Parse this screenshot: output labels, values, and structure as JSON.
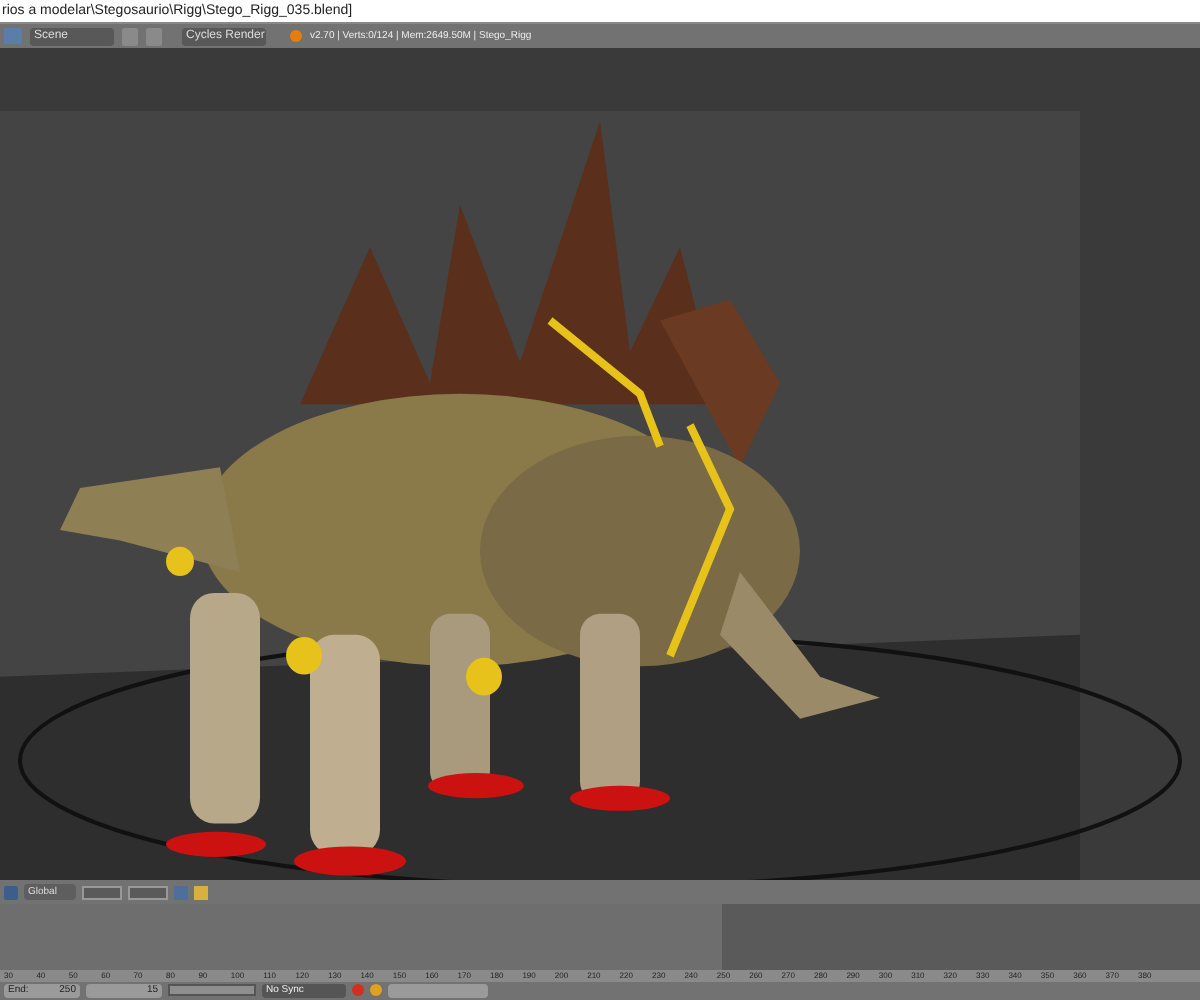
{
  "window": {
    "title": "rios a modelar\\Stegosaurio\\Rigg\\Stego_Rigg_035.blend]"
  },
  "info_header": {
    "scene": "Scene",
    "render_engine": "Cycles Render",
    "stats": "v2.70 | Verts:0/124 | Mem:2649.50M | Stego_Rigg"
  },
  "view_header": {
    "orientation": "Global"
  },
  "timeline": {
    "ticks": [
      "30",
      "40",
      "50",
      "60",
      "70",
      "80",
      "90",
      "100",
      "110",
      "120",
      "130",
      "140",
      "150",
      "160",
      "170",
      "180",
      "190",
      "200",
      "210",
      "220",
      "230",
      "240",
      "250",
      "260",
      "270",
      "280",
      "290",
      "300",
      "310",
      "320",
      "330",
      "340",
      "350",
      "360",
      "370",
      "380"
    ],
    "end": {
      "label": "End:",
      "value": "250"
    },
    "current_frame": "15",
    "sync": "No Sync"
  }
}
